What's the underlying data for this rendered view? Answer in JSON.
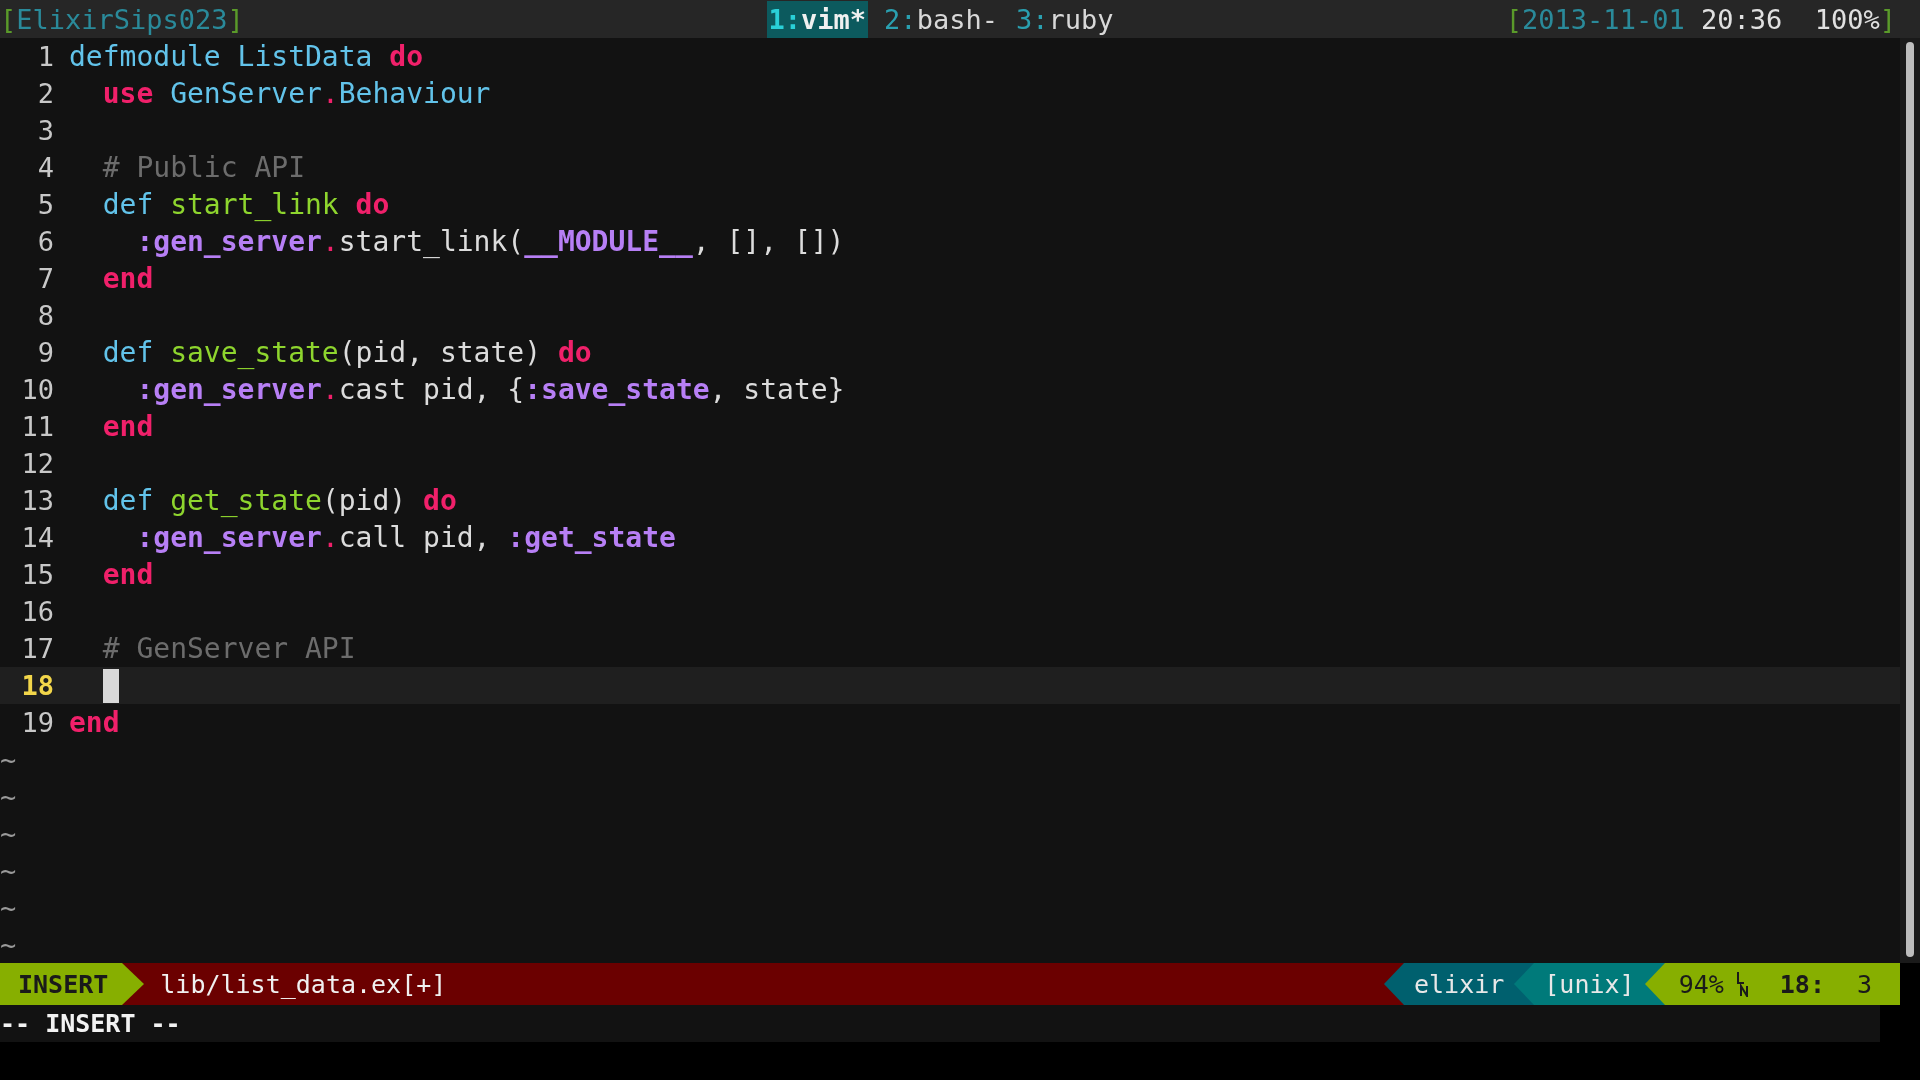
{
  "tmux_bar": {
    "open_bracket": "[",
    "session": "ElixirSips023",
    "close_bracket": "]",
    "windows": [
      {
        "index": "1:",
        "name": "vim*",
        "selected": true
      },
      {
        "index": "2:",
        "name": "bash-",
        "selected": false
      },
      {
        "index": "3:",
        "name": "ruby",
        "selected": false
      }
    ],
    "right_open_bracket": "[",
    "date": "2013-11-01",
    "time": "20:36",
    "battery": "100%",
    "right_close_bracket": "]"
  },
  "editor": {
    "lines": [
      {
        "number": "1",
        "current": false,
        "tokens": [
          {
            "kind": "keyword",
            "text": "defmodule"
          },
          {
            "kind": "module",
            "text": " ListData"
          },
          {
            "kind": "block",
            "text": " do"
          }
        ]
      },
      {
        "number": "2",
        "current": false,
        "tokens": [
          {
            "kind": "block",
            "text": "  use"
          },
          {
            "kind": "module",
            "text": " GenServer"
          },
          {
            "kind": "dot",
            "text": "."
          },
          {
            "kind": "module",
            "text": "Behaviour"
          }
        ]
      },
      {
        "number": "3",
        "current": false
      },
      {
        "number": "4",
        "current": false,
        "tokens": [
          {
            "kind": "comment",
            "text": "  # Public API"
          }
        ]
      },
      {
        "number": "5",
        "current": false,
        "tokens": [
          {
            "kind": "keyword",
            "text": "  def"
          },
          {
            "kind": "function",
            "text": " start_link"
          },
          {
            "kind": "block",
            "text": " do"
          }
        ]
      },
      {
        "number": "6",
        "current": false,
        "tokens": [
          {
            "kind": "atom",
            "text": "    :gen_server"
          },
          {
            "kind": "dot",
            "text": "."
          },
          {
            "kind": "plain",
            "text": "start_link("
          },
          {
            "kind": "atom",
            "text": "__MODULE__"
          },
          {
            "kind": "plain",
            "text": ", [], [])"
          }
        ]
      },
      {
        "number": "7",
        "current": false,
        "tokens": [
          {
            "kind": "block",
            "text": "  end"
          }
        ]
      },
      {
        "number": "8",
        "current": false
      },
      {
        "number": "9",
        "current": false,
        "tokens": [
          {
            "kind": "keyword",
            "text": "  def"
          },
          {
            "kind": "function",
            "text": " save_state"
          },
          {
            "kind": "plain",
            "text": "(pid, state)"
          },
          {
            "kind": "block",
            "text": " do"
          }
        ]
      },
      {
        "number": "10",
        "current": false,
        "tokens": [
          {
            "kind": "atom",
            "text": "    :gen_server"
          },
          {
            "kind": "dot",
            "text": "."
          },
          {
            "kind": "plain",
            "text": "cast pid, {"
          },
          {
            "kind": "atom",
            "text": ":save_state"
          },
          {
            "kind": "plain",
            "text": ", state}"
          }
        ]
      },
      {
        "number": "11",
        "current": false,
        "tokens": [
          {
            "kind": "block",
            "text": "  end"
          }
        ]
      },
      {
        "number": "12",
        "current": false
      },
      {
        "number": "13",
        "current": false,
        "tokens": [
          {
            "kind": "keyword",
            "text": "  def"
          },
          {
            "kind": "function",
            "text": " get_state"
          },
          {
            "kind": "plain",
            "text": "(pid)"
          },
          {
            "kind": "block",
            "text": " do"
          }
        ]
      },
      {
        "number": "14",
        "current": false,
        "tokens": [
          {
            "kind": "atom",
            "text": "    :gen_server"
          },
          {
            "kind": "dot",
            "text": "."
          },
          {
            "kind": "plain",
            "text": "call pid,"
          },
          {
            "kind": "atom",
            "text": " :get_state"
          }
        ]
      },
      {
        "number": "15",
        "current": false,
        "tokens": [
          {
            "kind": "block",
            "text": "  end"
          }
        ]
      },
      {
        "number": "16",
        "current": false
      },
      {
        "number": "17",
        "current": false,
        "tokens": [
          {
            "kind": "comment",
            "text": "  # GenServer API"
          }
        ]
      },
      {
        "number": "18",
        "current": true
      },
      {
        "number": "19",
        "current": false,
        "tokens": [
          {
            "kind": "block",
            "text": "end"
          }
        ]
      }
    ],
    "empty_lines": [
      "~",
      "~",
      "~",
      "~",
      "~",
      "~"
    ]
  },
  "status_line": {
    "mode": "INSERT",
    "file": "lib/list_data.ex[+]",
    "filetype": "elixir",
    "format": "[unix]",
    "percent": "94%",
    "line": "18:",
    "column": "3"
  },
  "command_line": "-- INSERT --"
}
